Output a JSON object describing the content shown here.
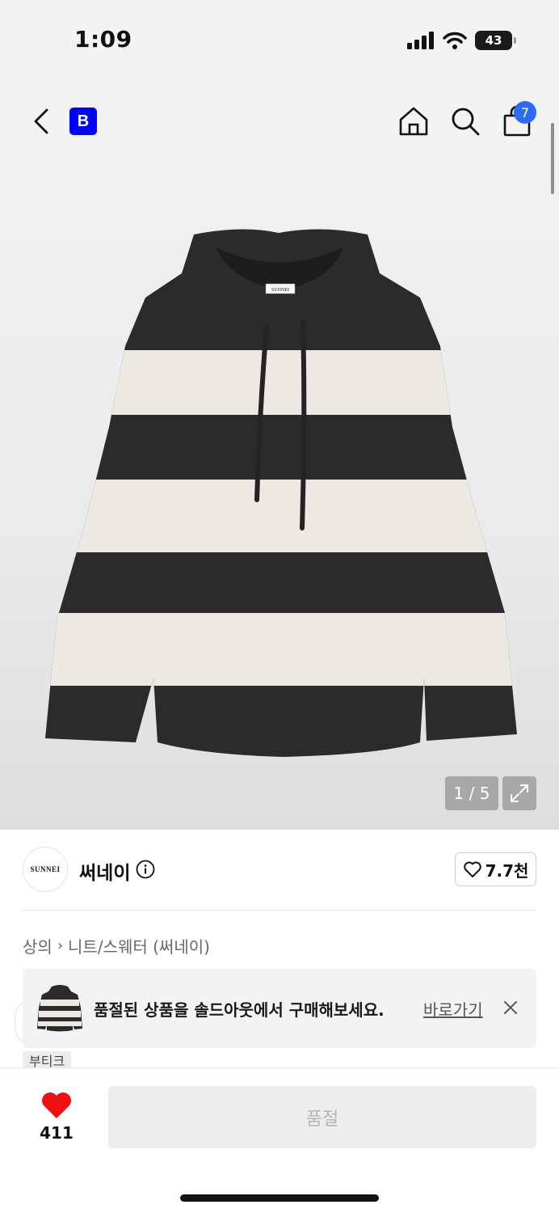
{
  "status_bar": {
    "time": "1:09",
    "battery": "43"
  },
  "nav": {
    "brand_logo": "B",
    "cart_count": "7",
    "icons": [
      "back-icon",
      "home-icon",
      "search-icon",
      "shopping-bag-icon"
    ]
  },
  "product_image": {
    "pager": "1 / 5",
    "sweater_label": "SUNNEI"
  },
  "brand": {
    "avatar_text": "SUNNEI",
    "name": "써네이",
    "likes": "7.7천"
  },
  "breadcrumb": {
    "category": "상의",
    "subcategory": "니트/스웨터 (써네이)"
  },
  "soldout_banner": {
    "message": "품절된 상품을 솔드아웃에서 구매해보세요.",
    "link": "바로가기"
  },
  "tag": "부티크",
  "bottom": {
    "like_count": "411",
    "buy_button": "품절"
  },
  "colors": {
    "accent_blue": "#2b6bf5",
    "brand_blue": "#0000ff",
    "heart_red": "#ee1111"
  }
}
